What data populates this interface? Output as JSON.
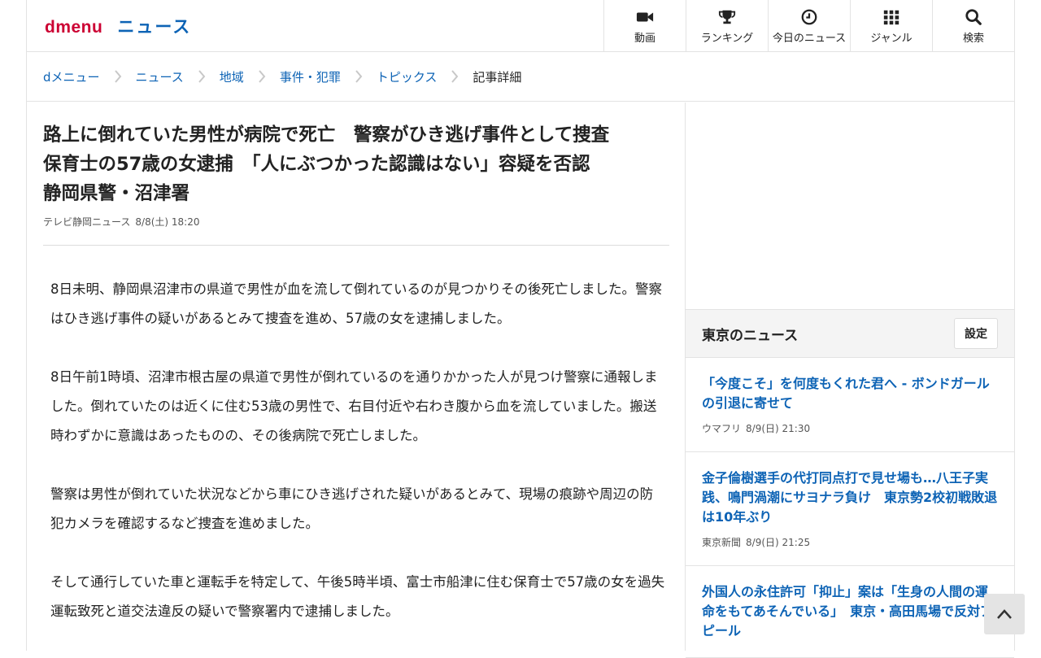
{
  "header": {
    "logo_main": "dmenu",
    "logo_section": "ニュース",
    "nav": [
      {
        "label": "動画",
        "icon": "video-camera-icon"
      },
      {
        "label": "ランキング",
        "icon": "trophy-icon"
      },
      {
        "label": "今日のニュース",
        "icon": "clock-icon"
      },
      {
        "label": "ジャンル",
        "icon": "grid-icon"
      },
      {
        "label": "検索",
        "icon": "search-icon"
      }
    ]
  },
  "breadcrumb": [
    {
      "label": "dメニュー"
    },
    {
      "label": "ニュース"
    },
    {
      "label": "地域"
    },
    {
      "label": "事件・犯罪"
    },
    {
      "label": "トピックス"
    },
    {
      "label": "記事詳細"
    }
  ],
  "article": {
    "title_lines": [
      "路上に倒れていた男性が病院で死亡　警察がひき逃げ事件として捜査",
      "保育士の57歳の女逮捕　「人にぶつかった認識はない」容疑を否認",
      "静岡県警・沼津署"
    ],
    "source": "テレビ静岡ニュース",
    "datetime": "8/8(土) 18:20",
    "paragraphs": [
      "8日未明、静岡県沼津市の県道で男性が血を流して倒れているのが見つかりその後死亡しました。警察はひき逃げ事件の疑いがあるとみて捜査を進め、57歳の女を逮捕しました。",
      "8日午前1時頃、沼津市根古屋の県道で男性が倒れているのを通りかかった人が見つけ警察に通報しました。倒れていたのは近くに住む53歳の男性で、右目付近や右わき腹から血を流していました。搬送時わずかに意識はあったものの、その後病院で死亡しました。",
      "警察は男性が倒れていた状況などから車にひき逃げされた疑いがあるとみて、現場の痕跡や周辺の防犯カメラを確認するなど捜査を進めました。",
      "そして通行していた車と運転手を特定して、午後5時半頃、富士市船津に住む保育士で57歳の女を過失運転致死と道交法違反の疑いで警察署内で逮捕しました。"
    ]
  },
  "sidebar": {
    "title": "東京のニュース",
    "setting_label": "設定",
    "items": [
      {
        "title": "「今度こそ」を何度もくれた君へ - ボンドガールの引退に寄せて",
        "source": "ウマフリ",
        "datetime": "8/9(日) 21:30"
      },
      {
        "title": "金子倫樹選手の代打同点打で見せ場も…八王子実践、鳴門渦潮にサヨナラ負け　東京勢2校初戦敗退は10年ぶり",
        "source": "東京新聞",
        "datetime": "8/9(日) 21:25"
      },
      {
        "title": "外国人の永住許可「抑止」案は「生身の人間の運命をもてあそんでいる」　東京・高田馬場で反対アピール",
        "source": "",
        "datetime": ""
      }
    ]
  },
  "colors": {
    "brand_red": "#cc0033",
    "link_blue": "#0d63b5",
    "text": "#222222",
    "border": "#e3e3e3"
  }
}
